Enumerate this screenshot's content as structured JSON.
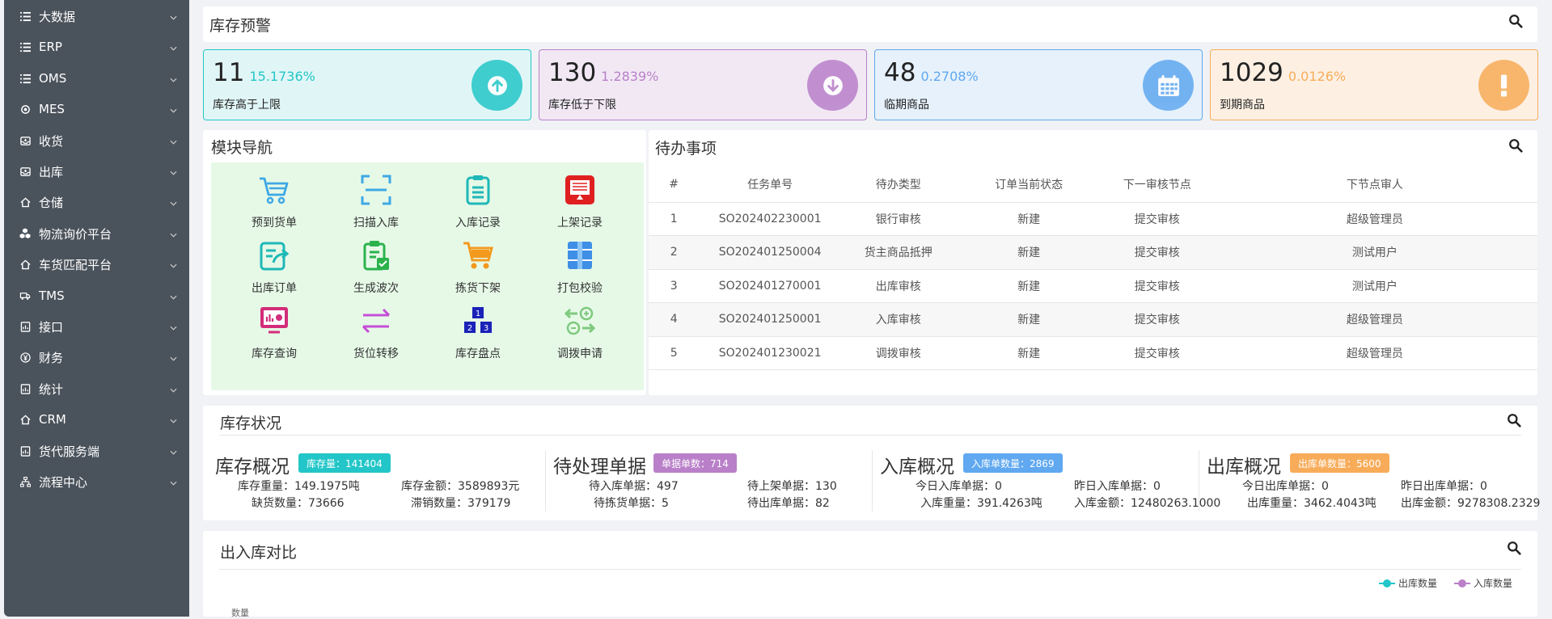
{
  "sidebar": {
    "items": [
      {
        "label": "大数据",
        "icon": "list-icon"
      },
      {
        "label": "ERP",
        "icon": "list-icon"
      },
      {
        "label": "OMS",
        "icon": "list-icon"
      },
      {
        "label": "MES",
        "icon": "gear-icon"
      },
      {
        "label": "收货",
        "icon": "inbox-icon"
      },
      {
        "label": "出库",
        "icon": "inbox-icon"
      },
      {
        "label": "仓储",
        "icon": "home-icon"
      },
      {
        "label": "物流询价平台",
        "icon": "cubes-icon"
      },
      {
        "label": "车货匹配平台",
        "icon": "home-icon"
      },
      {
        "label": "TMS",
        "icon": "truck-icon"
      },
      {
        "label": "接口",
        "icon": "report-icon"
      },
      {
        "label": "财务",
        "icon": "yen-icon"
      },
      {
        "label": "统计",
        "icon": "report-icon"
      },
      {
        "label": "CRM",
        "icon": "home-icon"
      },
      {
        "label": "货代服务端",
        "icon": "report-icon"
      },
      {
        "label": "流程中心",
        "icon": "sitemap-icon"
      }
    ]
  },
  "alert": {
    "title": "库存预警",
    "cards": [
      {
        "num": "11",
        "pct": "15.1736%",
        "label": "库存高于上限",
        "color": "#23c6c8",
        "bg": "#e0f6f6",
        "icon": "arrow-up-circle-icon"
      },
      {
        "num": "130",
        "pct": "1.2839%",
        "label": "库存低于下限",
        "color": "#b980c9",
        "bg": "#f1e8f4",
        "icon": "arrow-down-circle-icon"
      },
      {
        "num": "48",
        "pct": "0.2708%",
        "label": "临期商品",
        "color": "#60a8f0",
        "bg": "#e6f1fb",
        "icon": "calendar-icon"
      },
      {
        "num": "1029",
        "pct": "0.0126%",
        "label": "到期商品",
        "color": "#f8ac59",
        "bg": "#fdf0e3",
        "icon": "exclamation-icon"
      }
    ]
  },
  "modnav": {
    "title": "模块导航",
    "items": [
      {
        "label": "预到货单",
        "icon": "cart-icon"
      },
      {
        "label": "扫描入库",
        "icon": "scan-icon"
      },
      {
        "label": "入库记录",
        "icon": "clipboard-icon"
      },
      {
        "label": "上架记录",
        "icon": "shelf-record-icon"
      },
      {
        "label": "出库订单",
        "icon": "export-order-icon"
      },
      {
        "label": "生成波次",
        "icon": "clipboard-check-icon"
      },
      {
        "label": "拣货下架",
        "icon": "shopping-cart-icon"
      },
      {
        "label": "打包校验",
        "icon": "package-icon"
      },
      {
        "label": "库存查询",
        "icon": "monitor-chart-icon"
      },
      {
        "label": "货位转移",
        "icon": "transfer-icon"
      },
      {
        "label": "库存盘点",
        "icon": "inventory-blocks-icon"
      },
      {
        "label": "调拨申请",
        "icon": "allocate-icon"
      }
    ]
  },
  "todo": {
    "title": "待办事项",
    "headers": [
      "#",
      "任务单号",
      "待办类型",
      "订单当前状态",
      "下一审核节点",
      "下节点审人"
    ],
    "rows": [
      [
        "1",
        "SO202402230001",
        "银行审核",
        "新建",
        "提交审核",
        "超级管理员"
      ],
      [
        "2",
        "SO202401250004",
        "货主商品抵押",
        "新建",
        "提交审核",
        "测试用户"
      ],
      [
        "3",
        "SO202401270001",
        "出库审核",
        "新建",
        "提交审核",
        "测试用户"
      ],
      [
        "4",
        "SO202401250001",
        "入库审核",
        "新建",
        "提交审核",
        "超级管理员"
      ],
      [
        "5",
        "SO202401230021",
        "调拨审核",
        "新建",
        "提交审核",
        "超级管理员"
      ]
    ]
  },
  "status": {
    "title": "库存状况",
    "sections": [
      {
        "title": "库存概况",
        "badge": "库存量：141404",
        "badge_color": "#23c6c8",
        "kv": [
          "库存重量：149.1975吨",
          "库存金额：3589893元",
          "缺货数量：73666",
          "滞销数量：379179"
        ]
      },
      {
        "title": "待处理单据",
        "badge": "单据单数：714",
        "badge_color": "#b980c9",
        "kv": [
          "待入库单据：497",
          "待上架单据：130",
          "待拣货单据：5",
          "待出库单据：82"
        ]
      },
      {
        "title": "入库概况",
        "badge": "入库单数量：2869",
        "badge_color": "#60a8f0",
        "kv": [
          "今日入库单据：0",
          "昨日入库单据：0",
          "入库重量：391.4263吨",
          "入库金额：12480263.1000"
        ]
      },
      {
        "title": "出库概况",
        "badge": "出库单数量：5600",
        "badge_color": "#f8ac59",
        "kv": [
          "今日出库单据：0",
          "昨日出库单据：0",
          "出库重量：3462.4043吨",
          "出库金额：9278308.2329"
        ]
      }
    ]
  },
  "compare": {
    "title": "出入库对比",
    "legend": [
      {
        "label": "出库数量",
        "color": "#23c6c8"
      },
      {
        "label": "入库数量",
        "color": "#b980c9"
      }
    ],
    "ylabel": "数量"
  }
}
